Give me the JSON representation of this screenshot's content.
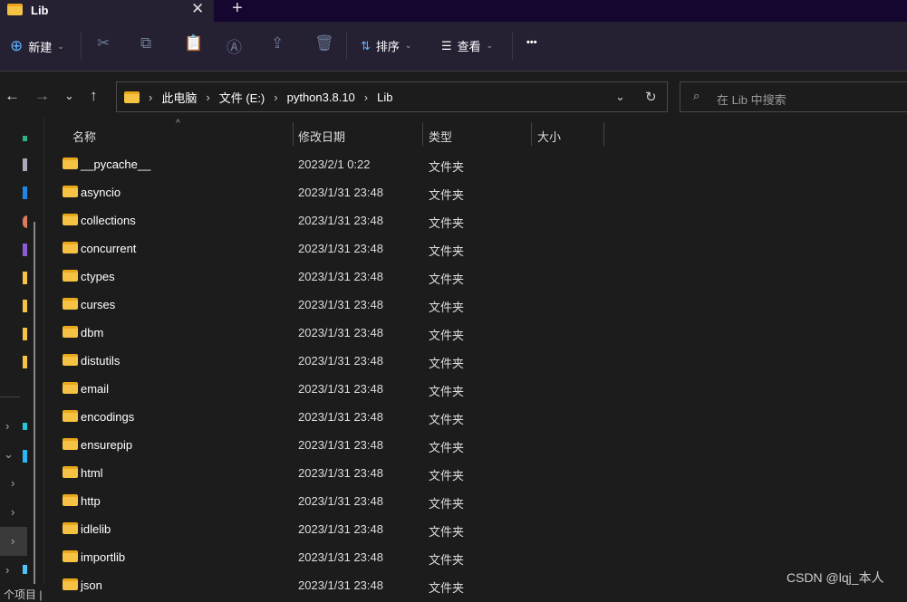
{
  "tab": {
    "title": "Lib",
    "close": "✕",
    "new_tab": "+"
  },
  "toolbar": {
    "new": "新建",
    "sort": "排序",
    "view": "查看",
    "more": "•••"
  },
  "address": {
    "crumbs": [
      "此电脑",
      "文件 (E:)",
      "python3.8.10",
      "Lib"
    ]
  },
  "search": {
    "placeholder": "在 Lib 中搜索"
  },
  "columns": {
    "name": "名称",
    "date": "修改日期",
    "type": "类型",
    "size": "大小"
  },
  "files": [
    {
      "name": "__pycache__",
      "date": "2023/2/1 0:22",
      "type": "文件夹"
    },
    {
      "name": "asyncio",
      "date": "2023/1/31 23:48",
      "type": "文件夹"
    },
    {
      "name": "collections",
      "date": "2023/1/31 23:48",
      "type": "文件夹"
    },
    {
      "name": "concurrent",
      "date": "2023/1/31 23:48",
      "type": "文件夹"
    },
    {
      "name": "ctypes",
      "date": "2023/1/31 23:48",
      "type": "文件夹"
    },
    {
      "name": "curses",
      "date": "2023/1/31 23:48",
      "type": "文件夹"
    },
    {
      "name": "dbm",
      "date": "2023/1/31 23:48",
      "type": "文件夹"
    },
    {
      "name": "distutils",
      "date": "2023/1/31 23:48",
      "type": "文件夹"
    },
    {
      "name": "email",
      "date": "2023/1/31 23:48",
      "type": "文件夹"
    },
    {
      "name": "encodings",
      "date": "2023/1/31 23:48",
      "type": "文件夹"
    },
    {
      "name": "ensurepip",
      "date": "2023/1/31 23:48",
      "type": "文件夹"
    },
    {
      "name": "html",
      "date": "2023/1/31 23:48",
      "type": "文件夹"
    },
    {
      "name": "http",
      "date": "2023/1/31 23:48",
      "type": "文件夹"
    },
    {
      "name": "idlelib",
      "date": "2023/1/31 23:48",
      "type": "文件夹"
    },
    {
      "name": "importlib",
      "date": "2023/1/31 23:48",
      "type": "文件夹"
    },
    {
      "name": "json",
      "date": "2023/1/31 23:48",
      "type": "文件夹"
    }
  ],
  "status": "个项目 |",
  "watermark": "CSDN @lqj_本人"
}
